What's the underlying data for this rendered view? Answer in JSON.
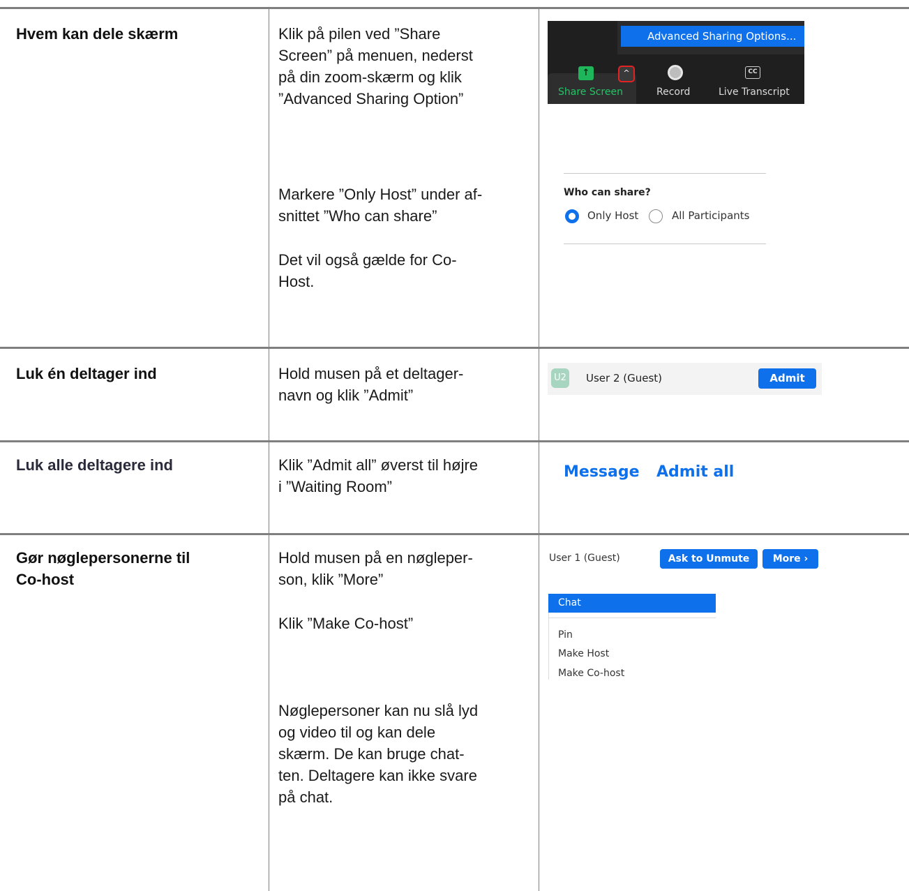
{
  "rows": [
    {
      "label": "Hvem kan dele skærm",
      "desc": [
        "Klik på pilen ved ”Share",
        "Screen” på menuen, nederst",
        "på din zoom-skærm og klik",
        "”Advanced Sharing Option”"
      ],
      "desc2": [
        "Markere ”Only Host” under af-",
        "snittet ”Who can share”"
      ],
      "desc3": [
        "Det vil også gælde for Co-",
        "Host."
      ]
    },
    {
      "label": "Luk én deltager ind",
      "desc": [
        "Hold musen på et deltager-",
        "navn og klik ”Admit”"
      ]
    },
    {
      "label": "Luk alle deltagere ind",
      "desc": [
        "Klik ”Admit all” øverst til højre",
        "i ”Waiting Room”"
      ]
    },
    {
      "label": [
        "Gør nøglepersonerne til",
        "Co-host"
      ],
      "desc": [
        "Hold musen på en nøgleper-",
        "son, klik ”More”"
      ],
      "desc2": [
        "Klik ”Make Co-host”"
      ],
      "desc3": [
        "Nøglepersoner kan nu slå lyd",
        "og video til og kan dele",
        "skærm. De kan bruge chat-",
        "ten. Deltagere kan ikke svare",
        "på chat."
      ]
    }
  ],
  "toolbar": {
    "menu_item": "Advanced Sharing Options...",
    "share_label": "Share Screen",
    "record_label": "Record",
    "transcript_label": "Live Transcript",
    "cc_text": "CC",
    "share_icon": "arrow-up-icon",
    "arrow_icon": "chevron-up-icon"
  },
  "who_share": {
    "title": "Who can share?",
    "option1": "Only Host",
    "option2": "All Participants"
  },
  "admit": {
    "avatar": "U2",
    "name": "User 2 (Guest)",
    "button": "Admit"
  },
  "waiting_room": {
    "message": "Message",
    "admit_all": "Admit all"
  },
  "participant": {
    "name": "User 1 (Guest)",
    "ask_unmute": "Ask to Unmute",
    "more": "More ›",
    "menu": [
      "Chat",
      "Pin",
      "Make Host",
      "Make Co-host"
    ]
  },
  "colors": {
    "accent": "#0e71eb",
    "share_green": "#23c467",
    "border": "#7f7f7f"
  }
}
